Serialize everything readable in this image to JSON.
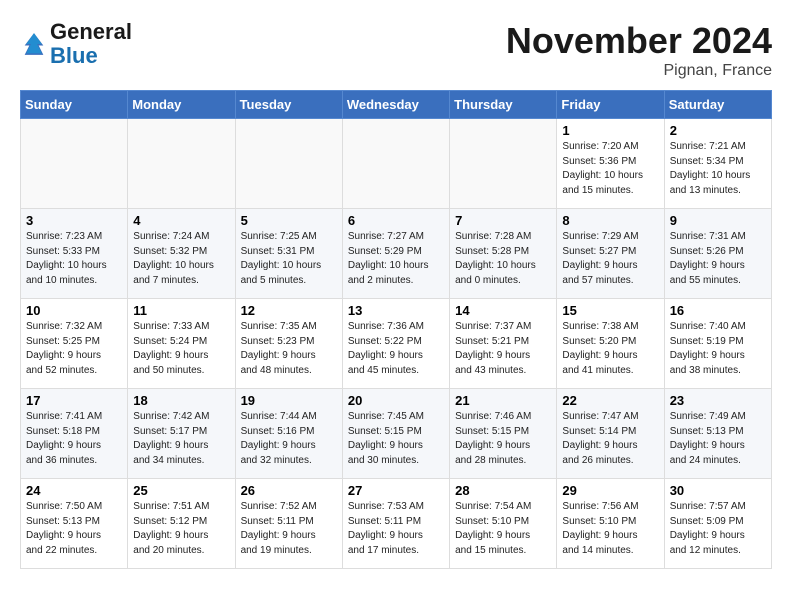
{
  "header": {
    "logo_general": "General",
    "logo_blue": "Blue",
    "month_title": "November 2024",
    "location": "Pignan, France"
  },
  "days_of_week": [
    "Sunday",
    "Monday",
    "Tuesday",
    "Wednesday",
    "Thursday",
    "Friday",
    "Saturday"
  ],
  "weeks": [
    [
      {
        "day": "",
        "info": ""
      },
      {
        "day": "",
        "info": ""
      },
      {
        "day": "",
        "info": ""
      },
      {
        "day": "",
        "info": ""
      },
      {
        "day": "",
        "info": ""
      },
      {
        "day": "1",
        "info": "Sunrise: 7:20 AM\nSunset: 5:36 PM\nDaylight: 10 hours\nand 15 minutes."
      },
      {
        "day": "2",
        "info": "Sunrise: 7:21 AM\nSunset: 5:34 PM\nDaylight: 10 hours\nand 13 minutes."
      }
    ],
    [
      {
        "day": "3",
        "info": "Sunrise: 7:23 AM\nSunset: 5:33 PM\nDaylight: 10 hours\nand 10 minutes."
      },
      {
        "day": "4",
        "info": "Sunrise: 7:24 AM\nSunset: 5:32 PM\nDaylight: 10 hours\nand 7 minutes."
      },
      {
        "day": "5",
        "info": "Sunrise: 7:25 AM\nSunset: 5:31 PM\nDaylight: 10 hours\nand 5 minutes."
      },
      {
        "day": "6",
        "info": "Sunrise: 7:27 AM\nSunset: 5:29 PM\nDaylight: 10 hours\nand 2 minutes."
      },
      {
        "day": "7",
        "info": "Sunrise: 7:28 AM\nSunset: 5:28 PM\nDaylight: 10 hours\nand 0 minutes."
      },
      {
        "day": "8",
        "info": "Sunrise: 7:29 AM\nSunset: 5:27 PM\nDaylight: 9 hours\nand 57 minutes."
      },
      {
        "day": "9",
        "info": "Sunrise: 7:31 AM\nSunset: 5:26 PM\nDaylight: 9 hours\nand 55 minutes."
      }
    ],
    [
      {
        "day": "10",
        "info": "Sunrise: 7:32 AM\nSunset: 5:25 PM\nDaylight: 9 hours\nand 52 minutes."
      },
      {
        "day": "11",
        "info": "Sunrise: 7:33 AM\nSunset: 5:24 PM\nDaylight: 9 hours\nand 50 minutes."
      },
      {
        "day": "12",
        "info": "Sunrise: 7:35 AM\nSunset: 5:23 PM\nDaylight: 9 hours\nand 48 minutes."
      },
      {
        "day": "13",
        "info": "Sunrise: 7:36 AM\nSunset: 5:22 PM\nDaylight: 9 hours\nand 45 minutes."
      },
      {
        "day": "14",
        "info": "Sunrise: 7:37 AM\nSunset: 5:21 PM\nDaylight: 9 hours\nand 43 minutes."
      },
      {
        "day": "15",
        "info": "Sunrise: 7:38 AM\nSunset: 5:20 PM\nDaylight: 9 hours\nand 41 minutes."
      },
      {
        "day": "16",
        "info": "Sunrise: 7:40 AM\nSunset: 5:19 PM\nDaylight: 9 hours\nand 38 minutes."
      }
    ],
    [
      {
        "day": "17",
        "info": "Sunrise: 7:41 AM\nSunset: 5:18 PM\nDaylight: 9 hours\nand 36 minutes."
      },
      {
        "day": "18",
        "info": "Sunrise: 7:42 AM\nSunset: 5:17 PM\nDaylight: 9 hours\nand 34 minutes."
      },
      {
        "day": "19",
        "info": "Sunrise: 7:44 AM\nSunset: 5:16 PM\nDaylight: 9 hours\nand 32 minutes."
      },
      {
        "day": "20",
        "info": "Sunrise: 7:45 AM\nSunset: 5:15 PM\nDaylight: 9 hours\nand 30 minutes."
      },
      {
        "day": "21",
        "info": "Sunrise: 7:46 AM\nSunset: 5:15 PM\nDaylight: 9 hours\nand 28 minutes."
      },
      {
        "day": "22",
        "info": "Sunrise: 7:47 AM\nSunset: 5:14 PM\nDaylight: 9 hours\nand 26 minutes."
      },
      {
        "day": "23",
        "info": "Sunrise: 7:49 AM\nSunset: 5:13 PM\nDaylight: 9 hours\nand 24 minutes."
      }
    ],
    [
      {
        "day": "24",
        "info": "Sunrise: 7:50 AM\nSunset: 5:13 PM\nDaylight: 9 hours\nand 22 minutes."
      },
      {
        "day": "25",
        "info": "Sunrise: 7:51 AM\nSunset: 5:12 PM\nDaylight: 9 hours\nand 20 minutes."
      },
      {
        "day": "26",
        "info": "Sunrise: 7:52 AM\nSunset: 5:11 PM\nDaylight: 9 hours\nand 19 minutes."
      },
      {
        "day": "27",
        "info": "Sunrise: 7:53 AM\nSunset: 5:11 PM\nDaylight: 9 hours\nand 17 minutes."
      },
      {
        "day": "28",
        "info": "Sunrise: 7:54 AM\nSunset: 5:10 PM\nDaylight: 9 hours\nand 15 minutes."
      },
      {
        "day": "29",
        "info": "Sunrise: 7:56 AM\nSunset: 5:10 PM\nDaylight: 9 hours\nand 14 minutes."
      },
      {
        "day": "30",
        "info": "Sunrise: 7:57 AM\nSunset: 5:09 PM\nDaylight: 9 hours\nand 12 minutes."
      }
    ]
  ]
}
